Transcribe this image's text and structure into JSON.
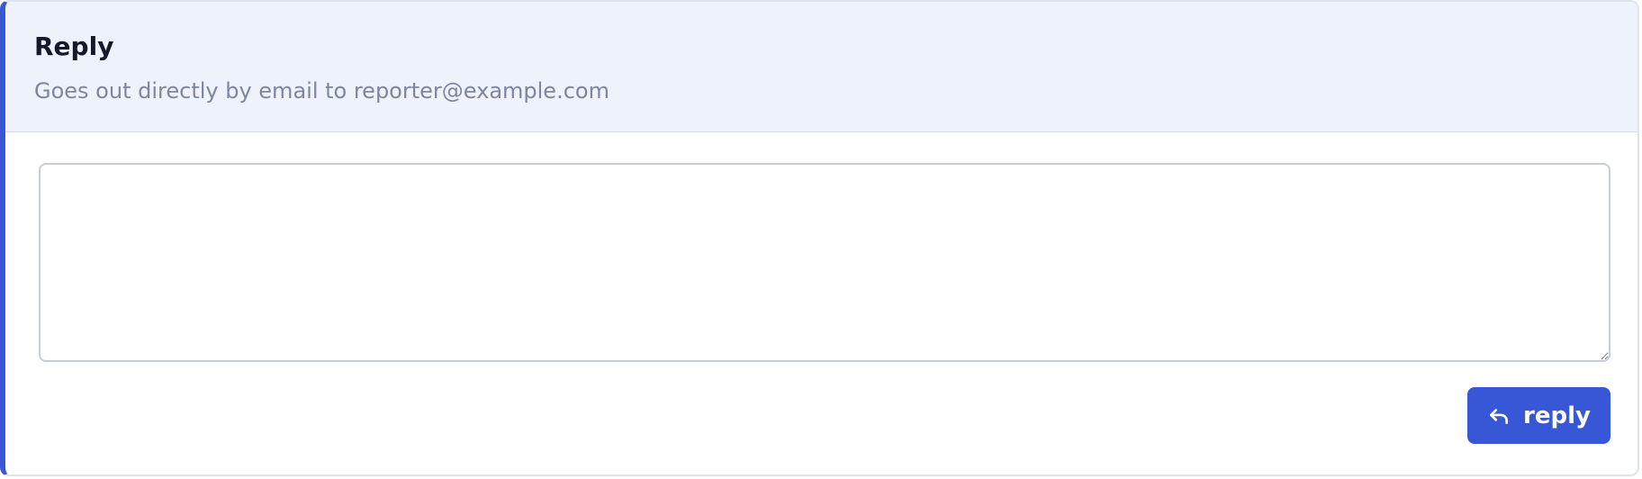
{
  "reply_panel": {
    "title": "Reply",
    "subtitle": "Goes out directly by email to reporter@example.com",
    "textarea": {
      "value": "",
      "placeholder": ""
    },
    "submit": {
      "label": "reply",
      "icon": "reply-arrow-icon"
    }
  },
  "colors": {
    "accent": "#3757d6",
    "header_bg": "#eef2fa",
    "title_text": "#141a2b",
    "subtitle_text": "#7d86a0",
    "border": "#c8cdda"
  }
}
